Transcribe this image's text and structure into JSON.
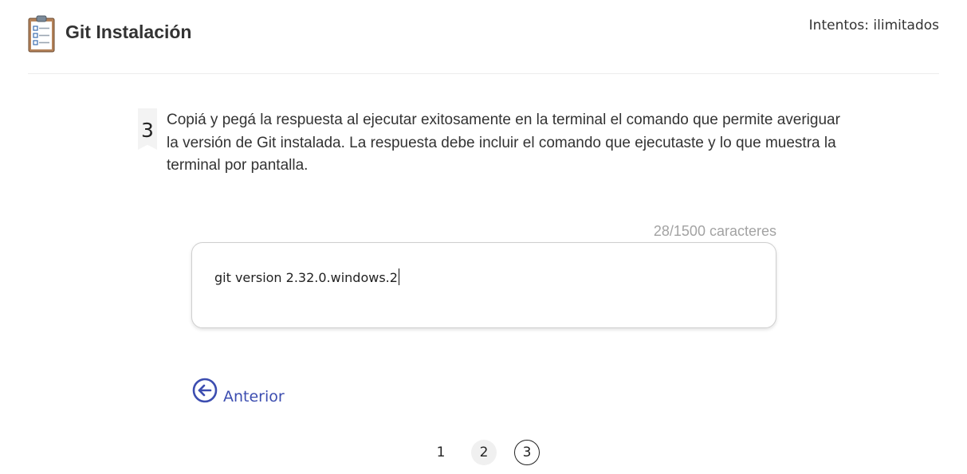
{
  "header": {
    "title": "Git Instalación",
    "attempts": "Intentos: ilimitados"
  },
  "question": {
    "number": "3",
    "text": "Copiá y pegá la respuesta al ejecutar exitosamente en la terminal el comando que permite averiguar la versión de Git instalada. La respuesta debe incluir el comando que ejecutaste y lo que muestra la terminal por pantalla."
  },
  "answer": {
    "counter": "28/1500 caracteres",
    "value": "git version 2.32.0.windows.2"
  },
  "nav": {
    "prev_label": "Anterior",
    "prev_icon": "arrow-left-circle-icon"
  },
  "pagination": {
    "pages": [
      "1",
      "2",
      "3"
    ],
    "current": "3"
  },
  "colors": {
    "accent": "#3c4db0",
    "counter": "#a3a3a3"
  }
}
